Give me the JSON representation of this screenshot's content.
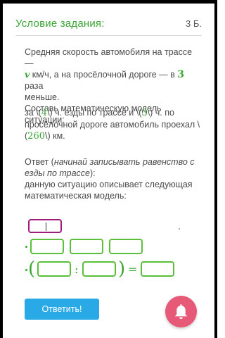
{
  "header": {
    "title": "Условие задания:",
    "points": "3 Б."
  },
  "problem": {
    "line1_a": "Средняя скорость автомобиля на трассе —",
    "var_v": "v",
    "line2_a": " км/ч, а на просёлочной дороге — в ",
    "factor": "3",
    "line2_b": " раза",
    "line3": "меньше.",
    "line4": "Составь математическую модель ситуации:"
  },
  "condition": {
    "a": "за \\(",
    "n1": "4",
    "b": "\\) ч. езды по трассе и \\(",
    "n2": "3",
    "c": "\\) ч. по просёлочной дороге автомобиль проехал \\(",
    "n3": "260",
    "d": "\\) км."
  },
  "answer_hint": {
    "prefix": "Ответ (",
    "italic": "начинай записывать равенство с езды по трассе",
    "suffix": "):",
    "rest": "данную ситуацию описывает следующая математическая модель:"
  },
  "model": {
    "colon": ":",
    "equals": "="
  },
  "buttons": {
    "answer_label": "Ответить!"
  },
  "colors": {
    "accent_green": "#3aa535",
    "box_green": "#5bbf3c",
    "purple": "#a01c7c",
    "button_blue": "#29a9e6",
    "fab_pink": "#e65a78"
  },
  "icons": {
    "fab": "bell-icon"
  }
}
